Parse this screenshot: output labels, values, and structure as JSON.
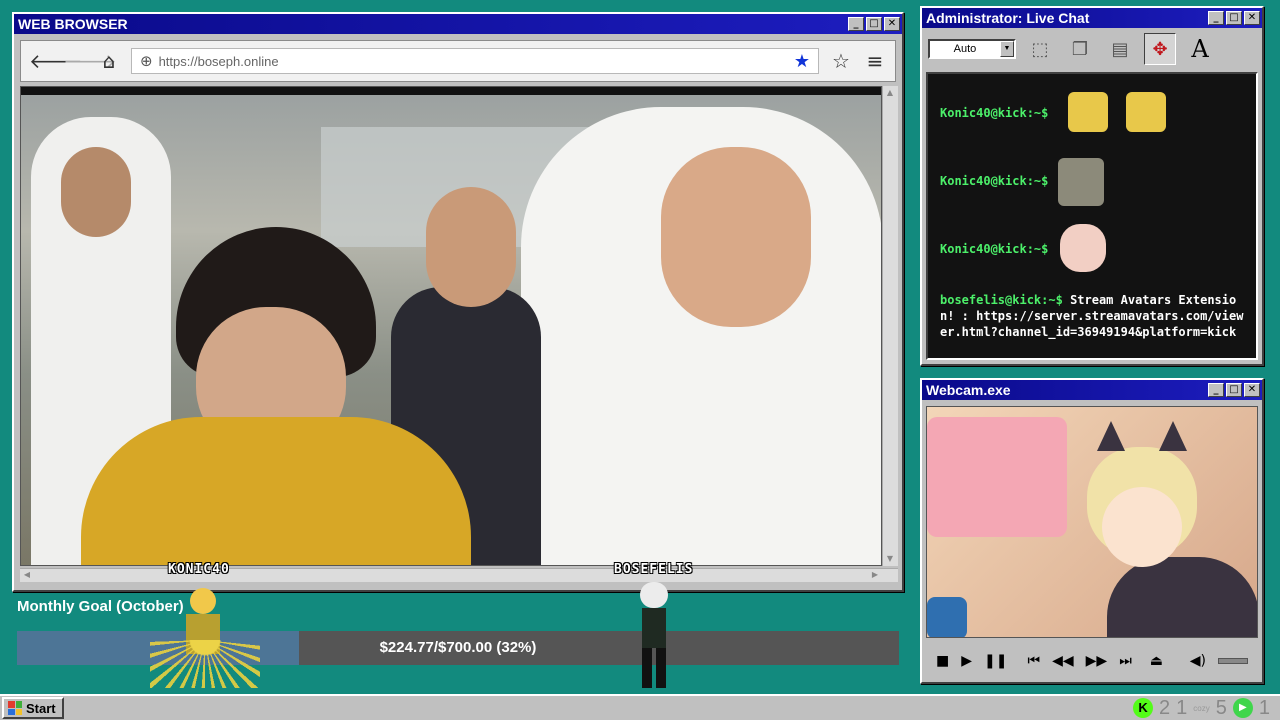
{
  "browser": {
    "title": "WEB BROWSER",
    "url": "https://boseph.online"
  },
  "chat": {
    "title": "Administrator: Live Chat",
    "mode": "Auto",
    "messages": [
      {
        "user": "Konic40@kick:~$",
        "text": ""
      },
      {
        "user": "Konic40@kick:~$",
        "text": ""
      },
      {
        "user": "Konic40@kick:~$",
        "text": ""
      },
      {
        "user": "bosefelis@kick:~$",
        "text": "Stream Avatars Extension! : https://server.streamavatars.com/viewer.html?channel_id=36949194&platform=kick"
      }
    ]
  },
  "webcam": {
    "title": "Webcam.exe"
  },
  "goal": {
    "title": "Monthly Goal (October)",
    "progress_text": "$224.77/$700.00 (32%)",
    "fraction": 0.32
  },
  "avatars": [
    {
      "name": "KONIC40"
    },
    {
      "name": "BOSEFELIS"
    }
  ],
  "taskbar": {
    "start_label": "Start",
    "count_a": "2",
    "count_b": "1",
    "cozy_label": "cozy",
    "count_c": "5",
    "count_d": "1"
  },
  "colors": {
    "desktop": "#128a7e",
    "titlebar": "#0a0a8a",
    "goal_fill": "#4d7596",
    "kick_green": "#53fc18"
  }
}
